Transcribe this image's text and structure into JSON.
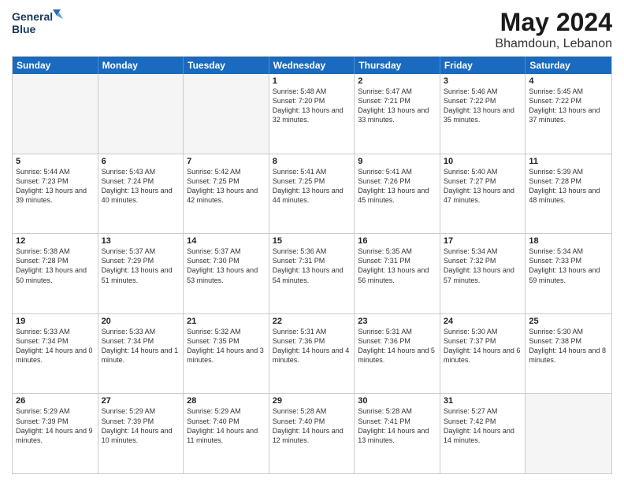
{
  "logo": {
    "line1": "General",
    "line2": "Blue"
  },
  "title": "May 2024",
  "subtitle": "Bhamdoun, Lebanon",
  "header_days": [
    "Sunday",
    "Monday",
    "Tuesday",
    "Wednesday",
    "Thursday",
    "Friday",
    "Saturday"
  ],
  "weeks": [
    [
      {
        "day": "",
        "sunrise": "",
        "sunset": "",
        "daylight": ""
      },
      {
        "day": "",
        "sunrise": "",
        "sunset": "",
        "daylight": ""
      },
      {
        "day": "",
        "sunrise": "",
        "sunset": "",
        "daylight": ""
      },
      {
        "day": "1",
        "sunrise": "Sunrise: 5:48 AM",
        "sunset": "Sunset: 7:20 PM",
        "daylight": "Daylight: 13 hours and 32 minutes."
      },
      {
        "day": "2",
        "sunrise": "Sunrise: 5:47 AM",
        "sunset": "Sunset: 7:21 PM",
        "daylight": "Daylight: 13 hours and 33 minutes."
      },
      {
        "day": "3",
        "sunrise": "Sunrise: 5:46 AM",
        "sunset": "Sunset: 7:22 PM",
        "daylight": "Daylight: 13 hours and 35 minutes."
      },
      {
        "day": "4",
        "sunrise": "Sunrise: 5:45 AM",
        "sunset": "Sunset: 7:22 PM",
        "daylight": "Daylight: 13 hours and 37 minutes."
      }
    ],
    [
      {
        "day": "5",
        "sunrise": "Sunrise: 5:44 AM",
        "sunset": "Sunset: 7:23 PM",
        "daylight": "Daylight: 13 hours and 39 minutes."
      },
      {
        "day": "6",
        "sunrise": "Sunrise: 5:43 AM",
        "sunset": "Sunset: 7:24 PM",
        "daylight": "Daylight: 13 hours and 40 minutes."
      },
      {
        "day": "7",
        "sunrise": "Sunrise: 5:42 AM",
        "sunset": "Sunset: 7:25 PM",
        "daylight": "Daylight: 13 hours and 42 minutes."
      },
      {
        "day": "8",
        "sunrise": "Sunrise: 5:41 AM",
        "sunset": "Sunset: 7:25 PM",
        "daylight": "Daylight: 13 hours and 44 minutes."
      },
      {
        "day": "9",
        "sunrise": "Sunrise: 5:41 AM",
        "sunset": "Sunset: 7:26 PM",
        "daylight": "Daylight: 13 hours and 45 minutes."
      },
      {
        "day": "10",
        "sunrise": "Sunrise: 5:40 AM",
        "sunset": "Sunset: 7:27 PM",
        "daylight": "Daylight: 13 hours and 47 minutes."
      },
      {
        "day": "11",
        "sunrise": "Sunrise: 5:39 AM",
        "sunset": "Sunset: 7:28 PM",
        "daylight": "Daylight: 13 hours and 48 minutes."
      }
    ],
    [
      {
        "day": "12",
        "sunrise": "Sunrise: 5:38 AM",
        "sunset": "Sunset: 7:28 PM",
        "daylight": "Daylight: 13 hours and 50 minutes."
      },
      {
        "day": "13",
        "sunrise": "Sunrise: 5:37 AM",
        "sunset": "Sunset: 7:29 PM",
        "daylight": "Daylight: 13 hours and 51 minutes."
      },
      {
        "day": "14",
        "sunrise": "Sunrise: 5:37 AM",
        "sunset": "Sunset: 7:30 PM",
        "daylight": "Daylight: 13 hours and 53 minutes."
      },
      {
        "day": "15",
        "sunrise": "Sunrise: 5:36 AM",
        "sunset": "Sunset: 7:31 PM",
        "daylight": "Daylight: 13 hours and 54 minutes."
      },
      {
        "day": "16",
        "sunrise": "Sunrise: 5:35 AM",
        "sunset": "Sunset: 7:31 PM",
        "daylight": "Daylight: 13 hours and 56 minutes."
      },
      {
        "day": "17",
        "sunrise": "Sunrise: 5:34 AM",
        "sunset": "Sunset: 7:32 PM",
        "daylight": "Daylight: 13 hours and 57 minutes."
      },
      {
        "day": "18",
        "sunrise": "Sunrise: 5:34 AM",
        "sunset": "Sunset: 7:33 PM",
        "daylight": "Daylight: 13 hours and 59 minutes."
      }
    ],
    [
      {
        "day": "19",
        "sunrise": "Sunrise: 5:33 AM",
        "sunset": "Sunset: 7:34 PM",
        "daylight": "Daylight: 14 hours and 0 minutes."
      },
      {
        "day": "20",
        "sunrise": "Sunrise: 5:33 AM",
        "sunset": "Sunset: 7:34 PM",
        "daylight": "Daylight: 14 hours and 1 minute."
      },
      {
        "day": "21",
        "sunrise": "Sunrise: 5:32 AM",
        "sunset": "Sunset: 7:35 PM",
        "daylight": "Daylight: 14 hours and 3 minutes."
      },
      {
        "day": "22",
        "sunrise": "Sunrise: 5:31 AM",
        "sunset": "Sunset: 7:36 PM",
        "daylight": "Daylight: 14 hours and 4 minutes."
      },
      {
        "day": "23",
        "sunrise": "Sunrise: 5:31 AM",
        "sunset": "Sunset: 7:36 PM",
        "daylight": "Daylight: 14 hours and 5 minutes."
      },
      {
        "day": "24",
        "sunrise": "Sunrise: 5:30 AM",
        "sunset": "Sunset: 7:37 PM",
        "daylight": "Daylight: 14 hours and 6 minutes."
      },
      {
        "day": "25",
        "sunrise": "Sunrise: 5:30 AM",
        "sunset": "Sunset: 7:38 PM",
        "daylight": "Daylight: 14 hours and 8 minutes."
      }
    ],
    [
      {
        "day": "26",
        "sunrise": "Sunrise: 5:29 AM",
        "sunset": "Sunset: 7:39 PM",
        "daylight": "Daylight: 14 hours and 9 minutes."
      },
      {
        "day": "27",
        "sunrise": "Sunrise: 5:29 AM",
        "sunset": "Sunset: 7:39 PM",
        "daylight": "Daylight: 14 hours and 10 minutes."
      },
      {
        "day": "28",
        "sunrise": "Sunrise: 5:29 AM",
        "sunset": "Sunset: 7:40 PM",
        "daylight": "Daylight: 14 hours and 11 minutes."
      },
      {
        "day": "29",
        "sunrise": "Sunrise: 5:28 AM",
        "sunset": "Sunset: 7:40 PM",
        "daylight": "Daylight: 14 hours and 12 minutes."
      },
      {
        "day": "30",
        "sunrise": "Sunrise: 5:28 AM",
        "sunset": "Sunset: 7:41 PM",
        "daylight": "Daylight: 14 hours and 13 minutes."
      },
      {
        "day": "31",
        "sunrise": "Sunrise: 5:27 AM",
        "sunset": "Sunset: 7:42 PM",
        "daylight": "Daylight: 14 hours and 14 minutes."
      },
      {
        "day": "",
        "sunrise": "",
        "sunset": "",
        "daylight": ""
      }
    ]
  ]
}
